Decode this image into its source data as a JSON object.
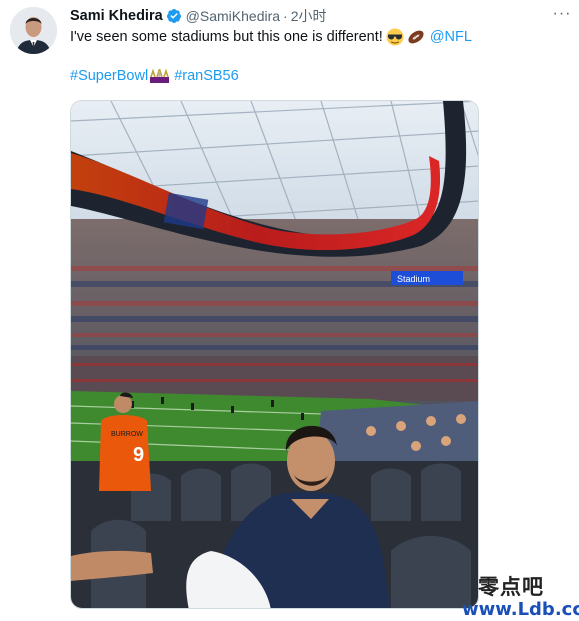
{
  "author": {
    "display_name": "Sami Khedira",
    "handle": "@SamiKhedira",
    "separator": "·",
    "time": "2小时",
    "verified": true,
    "avatar_icon": "profile-photo"
  },
  "tweet": {
    "text": "I've seen some stadiums but this one is different!",
    "emojis": [
      "sunglasses-emoji",
      "american-football-emoji"
    ],
    "mention": "@NFL",
    "hashtags": [
      "#SuperBowl",
      "#ranSB56"
    ],
    "hashtag_icon": "super-bowl-logo-icon",
    "more_icon": "more-options-icon"
  },
  "media": {
    "jersey_name": "BURROW",
    "jersey_number": "9",
    "screen_text": "Stadium"
  },
  "watermark": {
    "chinese": "零点吧",
    "url": "www.Ldb.cc"
  },
  "colors": {
    "link": "#1d9bf0",
    "verified": "#1d9bf0",
    "text": "#0f1419",
    "muted": "#536471"
  }
}
